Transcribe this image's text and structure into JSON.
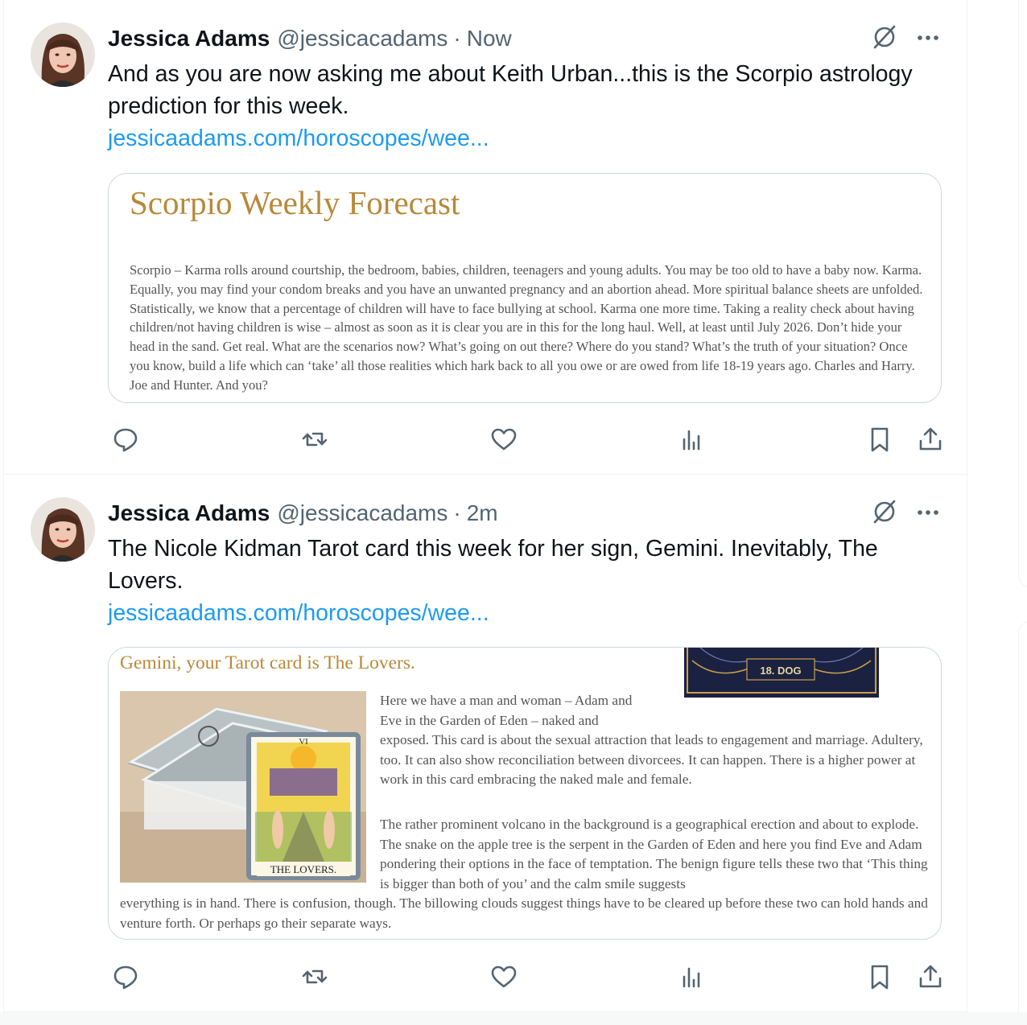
{
  "colors": {
    "accent": "#1d9bf0",
    "text": "#0f1419",
    "muted": "#536471",
    "card_title": "#b8893a",
    "border": "#cfd9de"
  },
  "tweets": [
    {
      "author_name": "Jessica Adams",
      "author_handle": "@jessicacadams",
      "separator": "·",
      "time": "Now",
      "text": "And as you are now asking me about Keith Urban...this is the Scorpio astrology prediction for this week.",
      "link_text": "jessicaadams.com/horoscopes/wee...",
      "card": {
        "title": "Scorpio Weekly Forecast",
        "body": "Scorpio – Karma rolls around courtship, the bedroom, babies, children, teenagers and young adults. You may be too old to have a baby now. Karma. Equally, you may find your condom breaks and you have an unwanted pregnancy and an abortion ahead. More spiritual balance sheets are unfolded. Statistically, we know that a percentage of children will have to face bullying at school. Karma one more time. Taking a reality check about having children/not having children is wise – almost as soon as it is clear you are in this for the long haul. Well, at least until July 2026. Don’t hide your head in the sand. Get real. What are the scenarios now? What’s going on out there? Where do you stand? What’s the truth of your situation? Once you know, build a life which can ‘take’ all those realities which hark back to all you owe or are owed from life 18-19 years ago. Charles and Harry. Joe and Hunter. And you?"
      },
      "actions": [
        "reply-icon",
        "retweet-icon",
        "like-icon",
        "views-icon",
        "bookmark-icon",
        "share-icon"
      ]
    },
    {
      "author_name": "Jessica Adams",
      "author_handle": "@jessicacadams",
      "separator": "·",
      "time": "2m",
      "text": "The Nicole Kidman Tarot card this week for her sign, Gemini. Inevitably, The Lovers.",
      "link_text": "jessicaadams.com/horoscopes/wee...",
      "card": {
        "title": "Gemini, your Tarot card is The Lovers.",
        "image_caption": "THE LOVERS.",
        "image_numeral": "VI",
        "side_card_label": "18. DOG",
        "para1_a": "Here we have a man and woman – Adam and Eve in the Garden of Eden – naked and",
        "para1_b": "exposed. This card is about the sexual attraction that leads to engagement and marriage. Adultery, too. It can also show reconciliation between divorcees. It can happen. There is a higher power at work in this card embracing the naked male and female.",
        "para2": "The rather prominent volcano in the background is a geographical erection and about to explode. The snake on the apple tree is the serpent in the Garden of Eden and here you find Eve and Adam pondering their options in the face of temptation. The benign figure tells these two that ‘This thing is bigger than both of you’ and the calm smile suggests",
        "para3": "everything is in hand. There is confusion, though. The billowing clouds suggest things have to be cleared up before these two can hold hands and venture forth. Or perhaps go their separate ways."
      },
      "actions": [
        "reply-icon",
        "retweet-icon",
        "like-icon",
        "views-icon",
        "bookmark-icon",
        "share-icon"
      ]
    }
  ]
}
